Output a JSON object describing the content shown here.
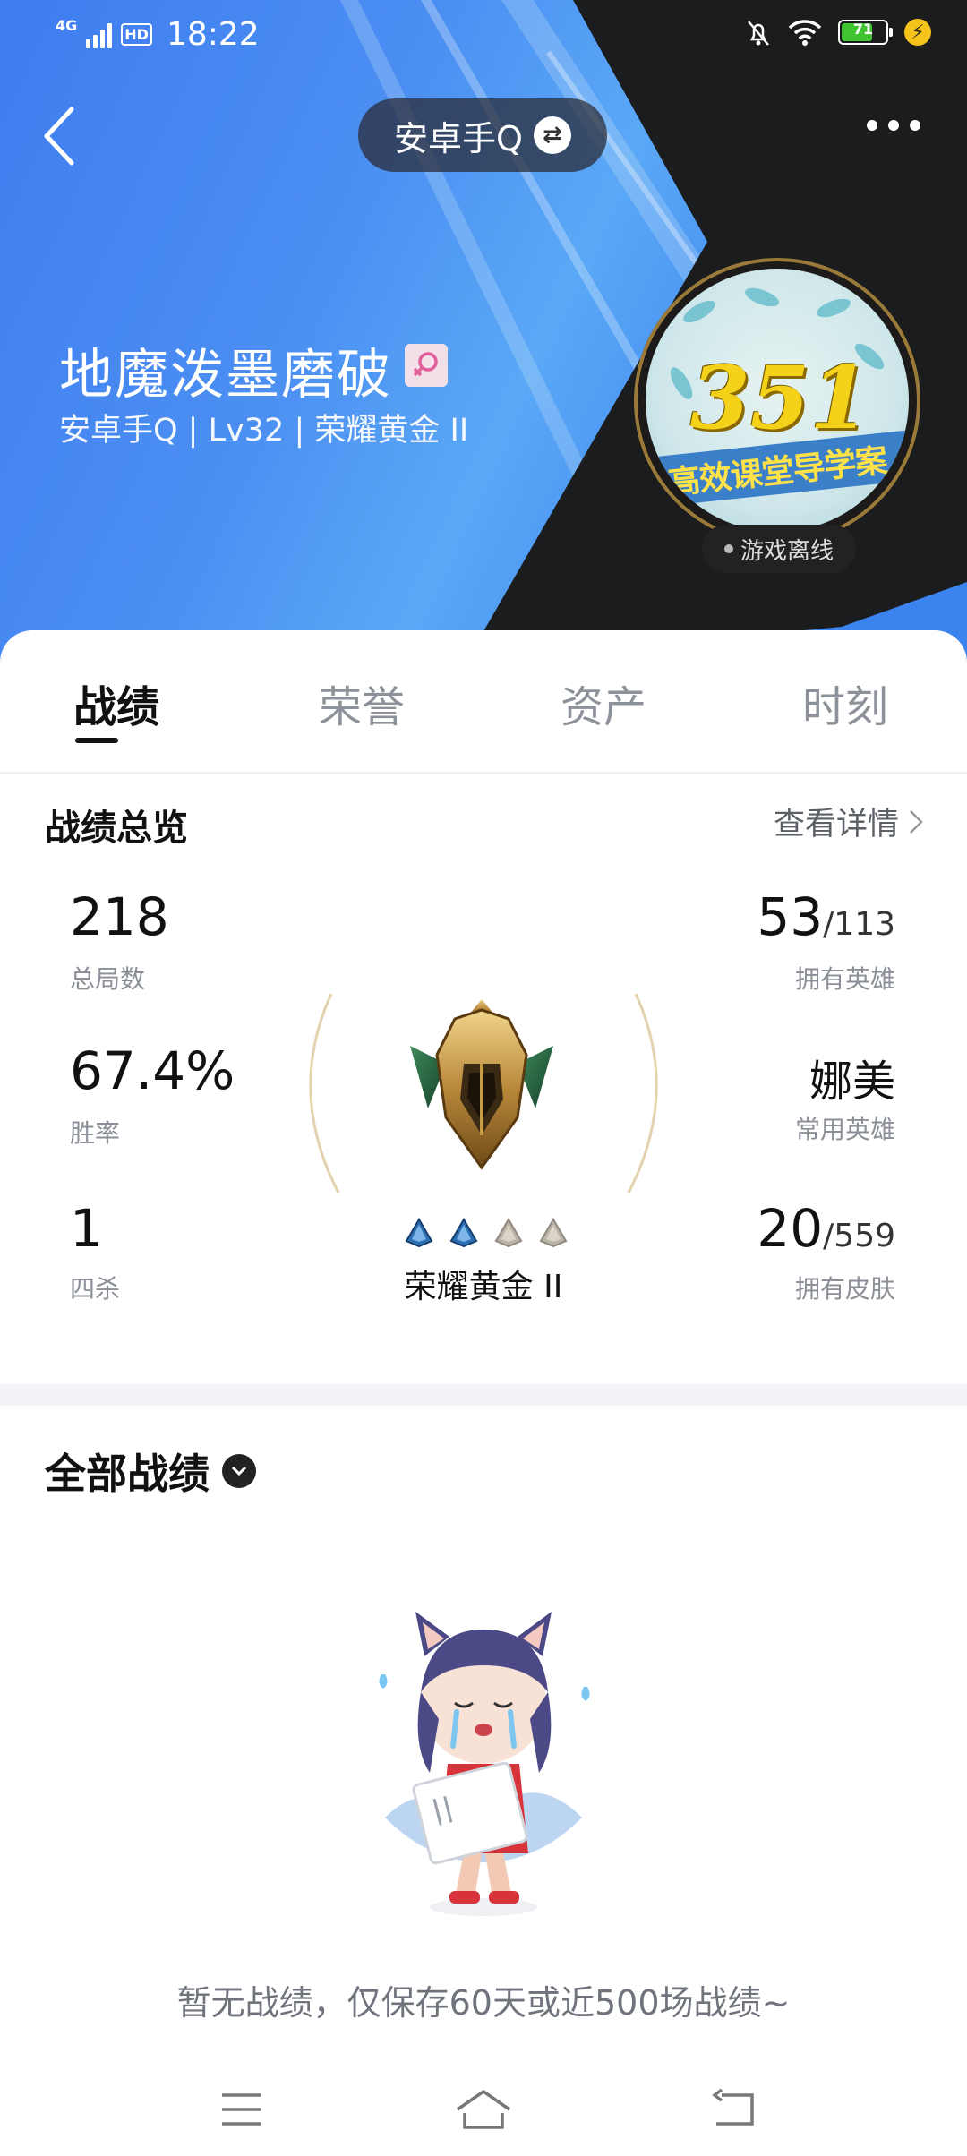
{
  "status_bar": {
    "network": "4G",
    "hd": "HD",
    "time": "18:22",
    "battery": "71",
    "battery_level": 0.71
  },
  "header": {
    "account_switch": "安卓手Q",
    "player_name": "地魔泼墨磨破",
    "player_meta": "安卓手Q | Lv32 | 荣耀黄金 II",
    "avatar_text": "351",
    "avatar_banner": "高效课堂导学案",
    "online_status": "游戏离线"
  },
  "tabs": [
    {
      "label": "战绩",
      "active": true
    },
    {
      "label": "荣誉",
      "active": false
    },
    {
      "label": "资产",
      "active": false
    },
    {
      "label": "时刻",
      "active": false
    }
  ],
  "overview": {
    "title": "战绩总览",
    "detail_link": "查看详情",
    "total_games": {
      "value": "218",
      "label": "总局数"
    },
    "win_rate": {
      "value": "67.4%",
      "label": "胜率"
    },
    "quadra_kills": {
      "value": "1",
      "label": "四杀"
    },
    "heroes_owned": {
      "value": "53",
      "total": "/113",
      "label": "拥有英雄"
    },
    "common_hero": {
      "value": "娜美",
      "label": "常用英雄"
    },
    "skins_owned": {
      "value": "20",
      "total": "/559",
      "label": "拥有皮肤"
    },
    "rank": {
      "name": "荣耀黄金 II",
      "diamonds_filled": 2,
      "diamonds_total": 4
    }
  },
  "records": {
    "title": "全部战绩",
    "empty_message": "暂无战绩，仅保存60天或近500场战绩~"
  },
  "colors": {
    "header_blue": "#4b8ff2",
    "gold": "#c9a45a",
    "diamond_blue": "#2c6fb3"
  }
}
